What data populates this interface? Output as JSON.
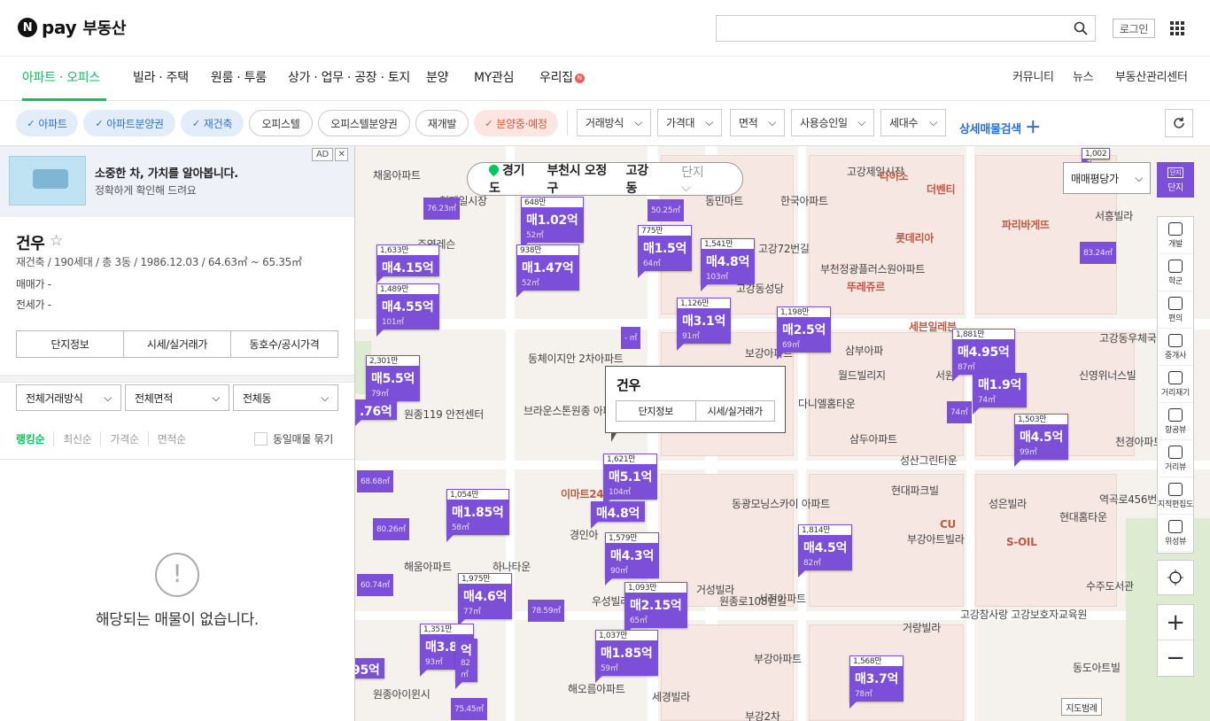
{
  "header": {
    "logo_n": "N",
    "logo_pay": "pay",
    "logo_service": "부동산",
    "search_placeholder": "",
    "login_label": "로그인"
  },
  "gnb": {
    "tabs": [
      "아파트 · 오피스텔",
      "빌라 · 주택",
      "원룸 · 투룸",
      "상가 · 업무 · 공장 · 토지",
      "분양",
      "MY관심",
      "우리집"
    ],
    "badge": "N",
    "right": [
      "커뮤니티",
      "뉴스",
      "부동산관리센터"
    ]
  },
  "filters": {
    "chips": [
      "아파트",
      "아파트분양권",
      "재건축",
      "오피스텔",
      "오피스텔분양권",
      "재개발",
      "분양중·예정"
    ],
    "selects": [
      "거래방식",
      "가격대",
      "면적",
      "사용승인일",
      "세대수"
    ],
    "advanced": "상세매물검색"
  },
  "left_panel": {
    "ad": {
      "title": "소중한 차, 가치를 알아봅니다.",
      "subtitle": "정확하게 확인해 드려요",
      "tag": "AD",
      "close": "✕"
    },
    "complex": {
      "name": "건우",
      "info": "재건축 / 190세대 / 총 3동 / 1986.12.03 / 64.63㎡ ~ 65.35㎡",
      "sale_label": "매매가 -",
      "jeonse_label": "전세가 -",
      "buttons": [
        "단지정보",
        "시세/실거래가",
        "동호수/공시가격"
      ]
    },
    "dropdowns": [
      "전체거래방식",
      "전체면적",
      "전체동"
    ],
    "sorts": [
      "랭킹순",
      "최신순",
      "가격순",
      "면적순"
    ],
    "group_label": "동일매물 묶기",
    "empty_text": "해당되는 매물이 없습니다."
  },
  "map": {
    "breadcrumb": [
      "경기도",
      "부천시 오정구",
      "고강동",
      "단지"
    ],
    "price_type": "매매평당가",
    "danji_label": "단지",
    "danji_icon": "단지",
    "tools": [
      {
        "icon": "development-icon",
        "label": "개발"
      },
      {
        "icon": "school-icon",
        "label": "학군"
      },
      {
        "icon": "convenience-icon",
        "label": "편의"
      },
      {
        "icon": "broker-icon",
        "label": "중개사"
      },
      {
        "icon": "ruler-icon",
        "label": "거리재기"
      },
      {
        "icon": "aerial-icon",
        "label": "항공뷰"
      },
      {
        "icon": "street-icon",
        "label": "거리뷰"
      },
      {
        "icon": "cadastral-icon",
        "label": "지적편집도"
      },
      {
        "icon": "satellite-icon",
        "label": "위성뷰"
      }
    ],
    "legend": "지도범례",
    "popup": {
      "title": "건우",
      "buttons": [
        "단지정보",
        "시세/실거래가"
      ]
    },
    "place_labels": [
      "채움아파트",
      "주영레슨",
      "천제일시장",
      "한국아파트",
      "동민마트",
      "고강72번길",
      "부천정광플러스원아파트",
      "고강동성당",
      "보강아파트",
      "다니엘홈타운",
      "삼두아파트",
      "성산그린타운",
      "동체이지안 2차아파트",
      "브라운스톤원종 아파트",
      "원종119 안전센터",
      "해움아파트",
      "하나타운",
      "경인아",
      "이마트24",
      "우성빌라",
      "거성빌라",
      "서전아파트",
      "부강아파트",
      "세경빌라",
      "해오름아파트",
      "원종아이윈시",
      "부강2차",
      "동광모닝스카이 아파트",
      "현대파크빌",
      "부강아트빌라",
      "거랑빌라",
      "고강참사랑 고강보호자교육원",
      "성은빌라",
      "동도아트빌",
      "현대홈타운",
      "신영위너스빌",
      "고강동우체국",
      "서원",
      "세븐일레븐",
      "뚜레쥬르",
      "롯데리아",
      "파리바게뜨",
      "월드빌리지",
      "고강제일시장",
      "다이소",
      "더벤티",
      "서흥빌라",
      "S-OIL",
      "수주도서관",
      "GS25",
      "CU",
      "천경아파트",
      "역곡로456번",
      "원종로108번길",
      "삼익아파",
      "삼부아파"
    ],
    "markers": [
      {
        "count": "1,633만",
        "price": "매4.15억",
        "area": ""
      },
      {
        "count": "1,489만",
        "price": "매4.55억",
        "area": "101㎡"
      },
      {
        "count": "648만",
        "price": "매1.02억",
        "area": "52㎡"
      },
      {
        "count": "938만",
        "price": "매1.47억",
        "area": "52㎡"
      },
      {
        "count": "775만",
        "price": "매1.5억",
        "area": "64㎡"
      },
      {
        "count": "1,541만",
        "price": "매4.8억",
        "area": "103㎡"
      },
      {
        "count": "1,126만",
        "price": "매3.1억",
        "area": "91㎡"
      },
      {
        "count": "1,198만",
        "price": "매2.5억",
        "area": "69㎡"
      },
      {
        "count": "1,881만",
        "price": "매4.95억",
        "area": "87㎡"
      },
      {
        "count": "",
        "price": "매1.9억",
        "area": "74㎡"
      },
      {
        "count": "1,503만",
        "price": "매4.5억",
        "area": "99㎡"
      },
      {
        "count": "2,301만",
        "price": "매5.5억",
        "area": "79㎡"
      },
      {
        "count": "",
        "price": ".76억",
        "area": ""
      },
      {
        "count": "1,621만",
        "price": "매5.1억",
        "area": "104㎡"
      },
      {
        "count": "",
        "price": "매4.8억",
        "area": ""
      },
      {
        "count": "1,579만",
        "price": "매4.3억",
        "area": "90㎡"
      },
      {
        "count": "1,054만",
        "price": "매1.85억",
        "area": "58㎡"
      },
      {
        "count": "1,975만",
        "price": "매4.6억",
        "area": "77㎡"
      },
      {
        "count": "1,093만",
        "price": "매2.15억",
        "area": "65㎡"
      },
      {
        "count": "1,037만",
        "price": "매1.85억",
        "area": "59㎡"
      },
      {
        "count": "1,351만",
        "price": "매3.8억",
        "area": "93㎡"
      },
      {
        "count": "",
        "price": "억",
        "area": "82㎡"
      },
      {
        "count": "",
        "price": "95억",
        "area": ""
      },
      {
        "count": "1,814만",
        "price": "매4.5억",
        "area": "82㎡"
      },
      {
        "count": "1,568만",
        "price": "매3.7억",
        "area": "78㎡"
      },
      {
        "count": "1,002만",
        "price": "",
        "area": ""
      }
    ],
    "area_markers": [
      "76.23㎡",
      "50.25㎡",
      "83.24㎡",
      "- ㎡",
      "74㎡",
      "68.68㎡",
      "80.26㎡",
      "60.74㎡",
      "78.59㎡",
      "75.45㎡"
    ]
  }
}
